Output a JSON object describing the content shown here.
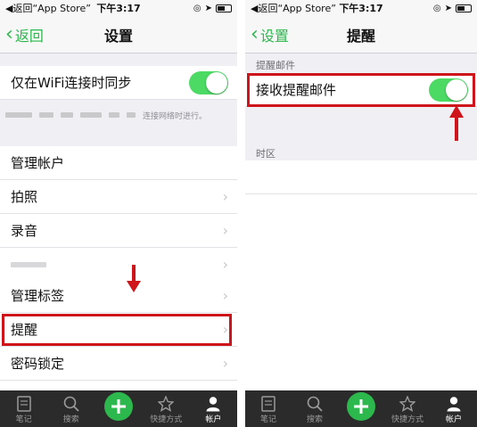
{
  "left": {
    "statusbar": {
      "back_app": "◀返回“App Store”",
      "time": "下午3:17"
    },
    "navbar": {
      "back_label": "返回",
      "title": "设置"
    },
    "wifi_sync": {
      "label": "仅在WiFi连接时同步"
    },
    "sync_note": "连接网络时进行。",
    "items": [
      {
        "label": "管理帐户"
      },
      {
        "label": "拍照"
      },
      {
        "label": "录音"
      },
      {
        "label": ""
      },
      {
        "label": "管理标签"
      },
      {
        "label": "提醒"
      },
      {
        "label": "密码锁定"
      }
    ]
  },
  "right": {
    "statusbar": {
      "back_app": "◀返回“App Store”",
      "time": "下午3:17"
    },
    "navbar": {
      "back_label": "设置",
      "title": "提醒"
    },
    "section_email": "提醒邮件",
    "receive_email": {
      "label": "接收提醒邮件"
    },
    "section_timezone": "时区"
  },
  "tabbar": {
    "tabs": [
      {
        "label": "笔记",
        "icon": "notes-icon"
      },
      {
        "label": "搜索",
        "icon": "search-icon"
      },
      {
        "label": "",
        "icon": "plus-icon"
      },
      {
        "label": "快捷方式",
        "icon": "star-icon"
      },
      {
        "label": "帐户",
        "icon": "account-icon"
      }
    ]
  },
  "colors": {
    "accent": "#2db84d",
    "toggle_on": "#4cd964",
    "highlight": "#d0141b",
    "tabbar_bg": "#2b2b2b"
  }
}
